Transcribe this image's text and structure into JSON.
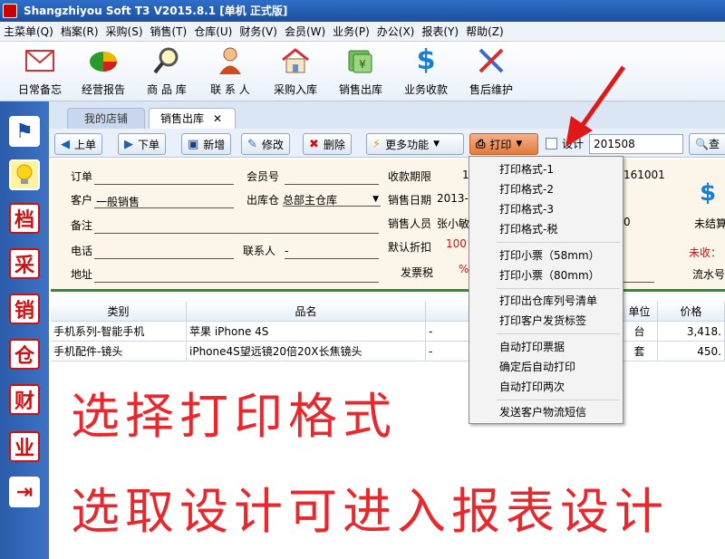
{
  "window": {
    "title": "Shangzhiyou Soft T3 V2015.8.1 [单机 正式版]"
  },
  "menu": [
    "主菜单(Q)",
    "档案(R)",
    "采购(S)",
    "销售(T)",
    "仓库(U)",
    "财务(V)",
    "会员(W)",
    "业务(P)",
    "办公(X)",
    "报表(Y)",
    "帮助(Z)"
  ],
  "toolbar": {
    "items": [
      {
        "label": "日常备忘",
        "icon": "mail-icon"
      },
      {
        "label": "经营报告",
        "icon": "pie-chart-icon"
      },
      {
        "label": "商 品 库",
        "icon": "magnifier-icon"
      },
      {
        "label": "联 系 人",
        "icon": "person-icon"
      },
      {
        "label": "采购入库",
        "icon": "house-icon"
      },
      {
        "label": "销售出库",
        "icon": "money-icon"
      },
      {
        "label": "业务收款",
        "icon": "dollar-icon"
      },
      {
        "label": "售后维护",
        "icon": "tools-icon"
      }
    ]
  },
  "sidebar": {
    "buttons": [
      {
        "name": "flag",
        "glyph": "⚑"
      },
      {
        "name": "bulb",
        "glyph": "💡"
      },
      {
        "name": "dang",
        "glyph": "档"
      },
      {
        "name": "cai",
        "glyph": "采"
      },
      {
        "name": "xiao",
        "glyph": "销"
      },
      {
        "name": "cang",
        "glyph": "仓"
      },
      {
        "name": "cai2",
        "glyph": "财"
      },
      {
        "name": "ye",
        "glyph": "业"
      },
      {
        "name": "exit",
        "glyph": "⇥"
      }
    ]
  },
  "tabs": {
    "store": "我的店铺",
    "sales": "销售出库",
    "close": "✕"
  },
  "actions": {
    "prev": "上单",
    "next": "下单",
    "add": "新增",
    "edit": "修改",
    "delete": "删除",
    "more": "更多功能",
    "print": "打印",
    "design": "设计",
    "search_value": "201508",
    "search": "查"
  },
  "form": {
    "order_label": "订单",
    "member_label": "会员号",
    "payment_term_label": "收款期限",
    "payment_term_value": "16",
    "order_no_partial": "161001",
    "customer_label": "客户",
    "customer_value": "一般销售",
    "warehouse_label": "出库仓",
    "warehouse_value": "总部主仓库",
    "sale_date_label": "销售日期",
    "sale_date_value": "2013-",
    "note_label": "备注",
    "salesperson_label": "销售人员",
    "salesperson_value": "张小敏",
    "phone_label": "电话",
    "contact_label": "联系人",
    "contact_value": "-",
    "discount_label": "默认折扣",
    "discount_value": "100",
    "address_label": "地址",
    "invoice_tax_label": "发票税",
    "invoice_tax_value": "%",
    "zero_value": "0",
    "unsettled_label": "未结算",
    "unreceived_label": "未收：",
    "serial_label": "流水号"
  },
  "grid": {
    "headers": [
      "类别",
      "品名",
      "单位",
      "价格"
    ],
    "rows": [
      {
        "category": "手机系列-智能手机",
        "name": "苹果 iPhone 4S",
        "spec": "-",
        "unit": "台",
        "price": "3,418."
      },
      {
        "category": "手机配件-镜头",
        "name": "iPhone4S望远镜20倍20X长焦镜头",
        "spec": "-",
        "unit": "套",
        "price": "450."
      }
    ]
  },
  "print_menu": {
    "groups": [
      [
        "打印格式-1",
        "打印格式-2",
        "打印格式-3",
        "打印格式-税"
      ],
      [
        "打印小票（58mm）",
        "打印小票（80mm）"
      ],
      [
        "打印出仓库列号清单",
        "打印客户发货标签"
      ],
      [
        "自动打印票据",
        "确定后自动打印",
        "自动打印两次"
      ],
      [
        "发送客户物流短信"
      ]
    ]
  },
  "annotations": {
    "line1": "选择打印格式",
    "line2": "选取设计可进入报表设计"
  },
  "colors": {
    "annotation": "#e8282c",
    "titlebar": "#2f6fc9",
    "print_button": "#e27a3e"
  }
}
